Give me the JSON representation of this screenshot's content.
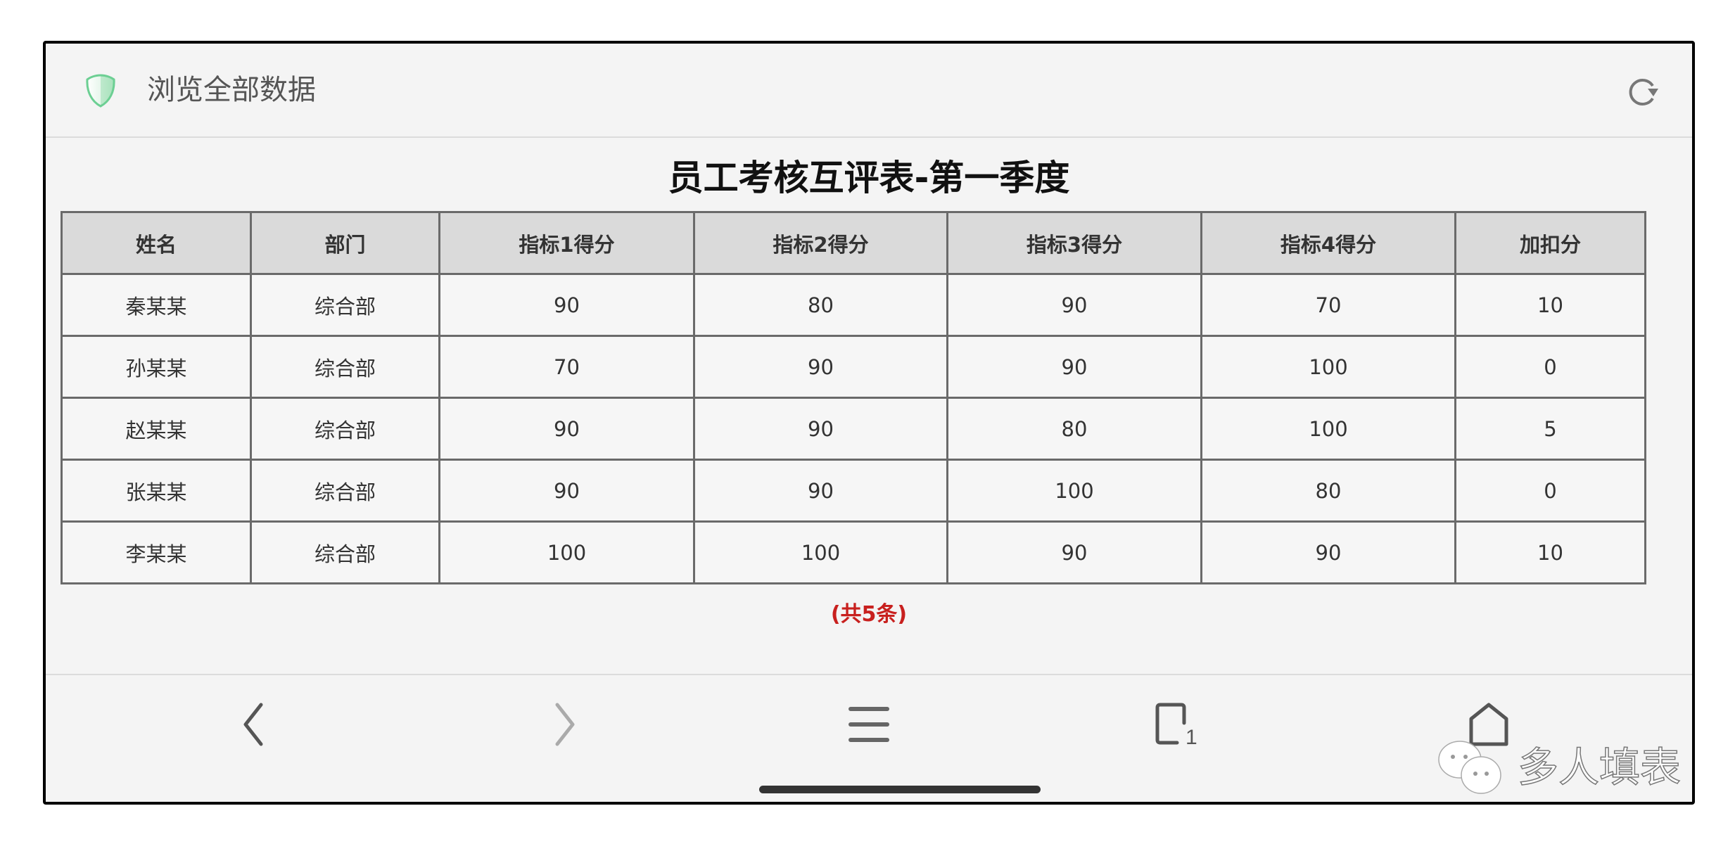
{
  "topbar": {
    "title": "浏览全部数据",
    "shield_icon": "shield-icon",
    "refresh_icon": "refresh-icon",
    "accent_color": "#6ccf93"
  },
  "sheet": {
    "title": "员工考核互评表-第一季度",
    "columns": [
      "姓名",
      "部门",
      "指标1得分",
      "指标2得分",
      "指标3得分",
      "指标4得分",
      "加扣分"
    ],
    "rows": [
      [
        "秦某某",
        "综合部",
        "90",
        "80",
        "90",
        "70",
        "10"
      ],
      [
        "孙某某",
        "综合部",
        "70",
        "90",
        "90",
        "100",
        "0"
      ],
      [
        "赵某某",
        "综合部",
        "90",
        "90",
        "80",
        "100",
        "5"
      ],
      [
        "张某某",
        "综合部",
        "90",
        "90",
        "100",
        "80",
        "0"
      ],
      [
        "李某某",
        "综合部",
        "100",
        "100",
        "90",
        "90",
        "10"
      ]
    ],
    "count_label": "(共5条)",
    "count_color": "#c8201e"
  },
  "navbar": {
    "back_icon": "chevron-left-icon",
    "forward_icon": "chevron-right-icon",
    "menu_icon": "menu-icon",
    "tabs_icon": "tabs-icon",
    "tabs_count": "1",
    "home_icon": "home-icon"
  },
  "watermark": {
    "text": "多人填表"
  }
}
